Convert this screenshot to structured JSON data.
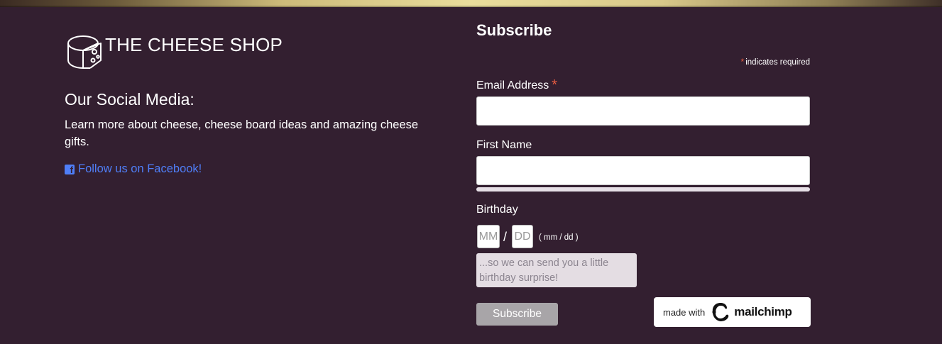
{
  "brand": {
    "name": "THE CHEESE SHOP",
    "logo_icon": "cheese-wheel-icon"
  },
  "social": {
    "title": "Our Social Media:",
    "description": "Learn more about cheese, cheese board ideas and amazing cheese gifts.",
    "facebook_icon": "facebook-square-icon",
    "facebook_link": "Follow us on Facebook!",
    "link_color": "#4f7ef7"
  },
  "subscribe": {
    "title": "Subscribe",
    "required_note": "indicates required",
    "required_marker": "*",
    "email_label": "Email Address",
    "email_value": "",
    "first_name_label": "First Name",
    "first_name_value": "",
    "birthday_label": "Birthday",
    "month_placeholder": "MM",
    "day_placeholder": "DD",
    "date_separator": "/",
    "date_hint": "( mm / dd )",
    "birthday_helper": "...so we can send you a little birthday surprise!",
    "button_label": "Subscribe"
  },
  "mailchimp_badge": {
    "made_with": "made with",
    "brand": "mailchimp",
    "icon": "mailchimp-freddie-icon"
  },
  "colors": {
    "background": "#331f30",
    "required": "#e85c41",
    "button": "#a8a5a8"
  }
}
